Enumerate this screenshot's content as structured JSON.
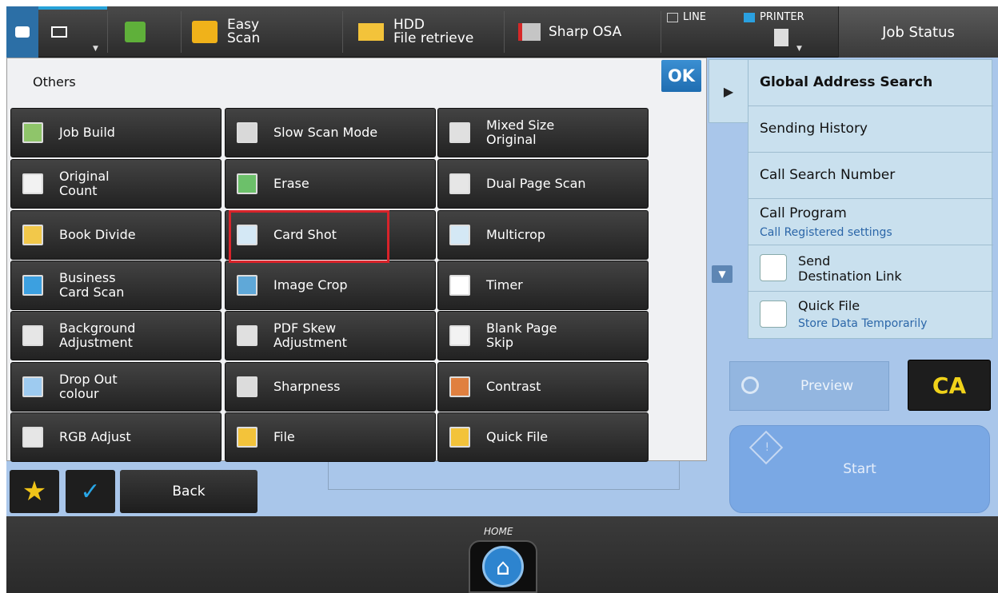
{
  "topbar": {
    "mail_icon": "envelope-icon",
    "copy_icon": "copy-icon",
    "easy_scan": "Easy\nScan",
    "hdd": "HDD\nFile retrieve",
    "sharp_osa": "Sharp OSA",
    "line": "LINE",
    "printer": "PRINTER",
    "job_status": "Job Status"
  },
  "popup": {
    "title": "Others",
    "ok": "OK",
    "buttons": [
      {
        "label": "Job Build",
        "icon": "job-build-icon"
      },
      {
        "label": "Slow Scan Mode",
        "icon": "slow-scan-icon"
      },
      {
        "label": "Mixed Size\nOriginal",
        "icon": "mixed-size-icon"
      },
      {
        "label": "Original\nCount",
        "icon": "original-count-icon"
      },
      {
        "label": "Erase",
        "icon": "erase-icon"
      },
      {
        "label": "Dual Page Scan",
        "icon": "dual-page-icon"
      },
      {
        "label": "Book Divide",
        "icon": "book-divide-icon"
      },
      {
        "label": "Card Shot",
        "icon": "card-shot-icon"
      },
      {
        "label": "Multicrop",
        "icon": "multicrop-icon"
      },
      {
        "label": "Business\nCard Scan",
        "icon": "business-card-icon"
      },
      {
        "label": "Image Crop",
        "icon": "image-crop-icon"
      },
      {
        "label": "Timer",
        "icon": "timer-icon"
      },
      {
        "label": "Background\nAdjustment",
        "icon": "background-icon"
      },
      {
        "label": "PDF Skew\nAdjustment",
        "icon": "pdf-skew-icon"
      },
      {
        "label": "Blank Page\nSkip",
        "icon": "blank-page-icon"
      },
      {
        "label": "Drop Out\ncolour",
        "icon": "drop-out-icon"
      },
      {
        "label": "Sharpness",
        "icon": "sharpness-icon"
      },
      {
        "label": "Contrast",
        "icon": "contrast-icon"
      },
      {
        "label": "RGB Adjust",
        "icon": "rgb-icon"
      },
      {
        "label": "File",
        "icon": "folder-icon"
      },
      {
        "label": "Quick File",
        "icon": "quick-file-icon"
      }
    ]
  },
  "right_panel": {
    "global_address": "Global Address Search",
    "sending_history": "Sending History",
    "call_search": "Call Search Number",
    "call_program": "Call Program",
    "call_program_sub": "Call Registered settings",
    "send_link": "Send\nDestination Link",
    "quick_file": "Quick File",
    "quick_file_sub": "Store Data Temporarily"
  },
  "actions": {
    "preview": "Preview",
    "ca": "CA",
    "start": "Start",
    "back": "Back"
  },
  "footer": {
    "home": "HOME"
  },
  "colors": {
    "accent_blue": "#2c6fa6",
    "highlight_red": "#d8232a",
    "ca_yellow": "#f0d21a"
  }
}
